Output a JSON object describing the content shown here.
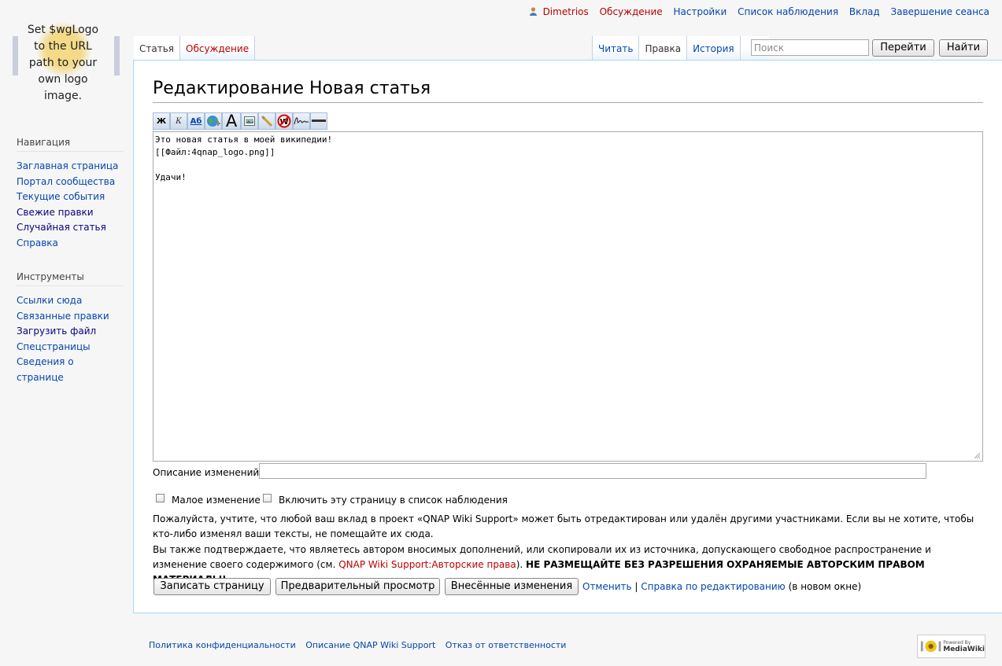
{
  "logo": {
    "text_lines": [
      "Set $wgLogo",
      "to the URL",
      "path to your",
      "own logo",
      "image."
    ]
  },
  "personal": {
    "username": "Dimetrios",
    "talk": "Обсуждение",
    "preferences": "Настройки",
    "watchlist": "Список наблюдения",
    "contributions": "Вклад",
    "logout": "Завершение сеанса"
  },
  "namespaces": [
    {
      "label": "Статья"
    },
    {
      "label": "Обсуждение"
    }
  ],
  "views": [
    {
      "label": "Читать"
    },
    {
      "label": "Правка"
    },
    {
      "label": "История"
    }
  ],
  "search": {
    "placeholder": "Поиск",
    "go_label": "Перейти",
    "search_label": "Найти"
  },
  "sidebar": {
    "navigation": {
      "heading": "Навигация",
      "items": [
        "Заглавная страница",
        "Портал сообщества",
        "Текущие события",
        "Свежие правки",
        "Случайная статья",
        "Справка"
      ]
    },
    "tools": {
      "heading": "Инструменты",
      "items": [
        "Ссылки сюда",
        "Связанные правки",
        "Загрузить файл",
        "Спецстраницы",
        "Сведения о странице"
      ]
    }
  },
  "heading": "Редактирование Новая статья",
  "toolbar": {
    "bold_label": "Ж",
    "italic_label": "К",
    "link_label": "Аб",
    "headline_label": "A",
    "icons": [
      "bold-icon",
      "italic-icon",
      "internal-link-icon",
      "external-link-icon",
      "headline-icon",
      "image-icon",
      "media-icon",
      "nowiki-icon",
      "signature-icon",
      "horizontal-line-icon"
    ]
  },
  "editor": {
    "content": "Это новая статья в моей википедии!\n[[Файл:4qnap_logo.png]]\n\nУдачи!"
  },
  "summary": {
    "label": "Описание изменений:",
    "value": ""
  },
  "options": {
    "minor_label": "Малое изменение",
    "watch_label": "Включить эту страницу в список наблюдения"
  },
  "notice": {
    "line1": "Пожалуйста, учтите, что любой ваш вклад в проект «QNAP Wiki Support» может быть отредактирован или удалён другими участниками. Если вы не хотите, чтобы кто-либо изменял ваши тексты, не помещайте их сюда.",
    "line2_prefix": "Вы также подтверждаете, что являетесь автором вносимых дополнений, или скопировали их из источника, допускающего свободное распространение и изменение своего содержимого (см. ",
    "line2_link": "QNAP Wiki Support:Авторские права",
    "line2_suffix": "). ",
    "line2_bold": "НЕ РАЗМЕЩАЙТЕ БЕЗ РАЗРЕШЕНИЯ ОХРАНЯЕМЫЕ АВТОРСКИМ ПРАВОМ МАТЕРИАЛЫ!"
  },
  "actions": {
    "save_label": "Записать страницу",
    "preview_label": "Предварительный просмотр",
    "diff_label": "Внесённые изменения",
    "cancel_label": "Отменить",
    "separator": "|",
    "help_label": "Справка по редактированию",
    "help_suffix": "(в новом окне)"
  },
  "footer": {
    "privacy": "Политика конфиденциальности",
    "about": "Описание QNAP Wiki Support",
    "disclaimer": "Отказ от ответственности",
    "powered_by_lines": [
      "Powered By",
      "MediaWiki"
    ]
  },
  "colors": {
    "link": "#0645ad",
    "redlink": "#ba0000",
    "border": "#a7d7f9"
  }
}
